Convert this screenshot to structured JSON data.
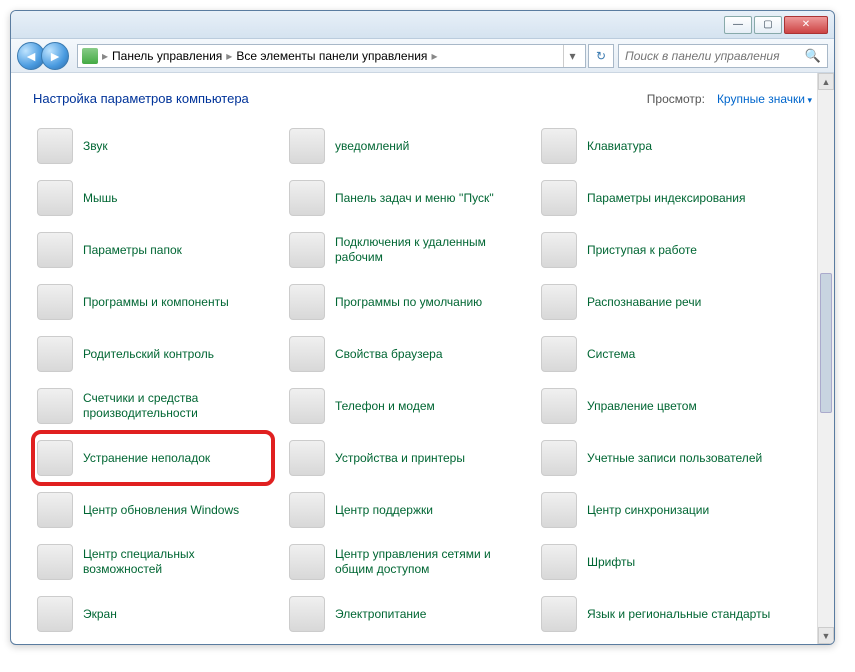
{
  "breadcrumbs": {
    "level1": "Панель управления",
    "level2": "Все элементы панели управления"
  },
  "search": {
    "placeholder": "Поиск в панели управления"
  },
  "header": {
    "title": "Настройка параметров компьютера",
    "view_label": "Просмотр:",
    "view_value": "Крупные значки"
  },
  "items": [
    {
      "label": "Звук",
      "icon": "ic-gray",
      "name": "sound-item"
    },
    {
      "label": "уведомлений",
      "icon": "ic-gray",
      "name": "notification-icons-item"
    },
    {
      "label": "Клавиатура",
      "icon": "ic-gray",
      "name": "keyboard-item"
    },
    {
      "label": "Мышь",
      "icon": "ic-gray",
      "name": "mouse-item"
    },
    {
      "label": "Панель задач и меню ''Пуск''",
      "icon": "ic-blue",
      "name": "taskbar-start-item"
    },
    {
      "label": "Параметры индексирования",
      "icon": "ic-gray",
      "name": "indexing-options-item"
    },
    {
      "label": "Параметры папок",
      "icon": "ic-yellow",
      "name": "folder-options-item"
    },
    {
      "label": "Подключения к удаленным рабочим",
      "icon": "ic-blue",
      "name": "remote-desktop-item"
    },
    {
      "label": "Приступая к работе",
      "icon": "ic-blue",
      "name": "getting-started-item"
    },
    {
      "label": "Программы и компоненты",
      "icon": "ic-gray",
      "name": "programs-features-item"
    },
    {
      "label": "Программы по умолчанию",
      "icon": "ic-green",
      "name": "default-programs-item"
    },
    {
      "label": "Распознавание речи",
      "icon": "ic-gray",
      "name": "speech-recognition-item"
    },
    {
      "label": "Родительский контроль",
      "icon": "ic-green",
      "name": "parental-controls-item"
    },
    {
      "label": "Свойства браузера",
      "icon": "ic-teal",
      "name": "internet-options-item"
    },
    {
      "label": "Система",
      "icon": "ic-blue",
      "name": "system-item"
    },
    {
      "label": "Счетчики и средства производительности",
      "icon": "ic-teal",
      "name": "performance-item"
    },
    {
      "label": "Телефон и модем",
      "icon": "ic-gray",
      "name": "phone-modem-item"
    },
    {
      "label": "Управление цветом",
      "icon": "ic-blue",
      "name": "color-management-item"
    },
    {
      "label": "Устранение неполадок",
      "icon": "ic-blue",
      "name": "troubleshooting-item",
      "hl": true
    },
    {
      "label": "Устройства и принтеры",
      "icon": "ic-gray",
      "name": "devices-printers-item"
    },
    {
      "label": "Учетные записи пользователей",
      "icon": "ic-green",
      "name": "user-accounts-item"
    },
    {
      "label": "Центр обновления Windows",
      "icon": "ic-orange",
      "name": "windows-update-item"
    },
    {
      "label": "Центр поддержки",
      "icon": "ic-blue",
      "name": "action-center-item"
    },
    {
      "label": "Центр синхронизации",
      "icon": "ic-green",
      "name": "sync-center-item"
    },
    {
      "label": "Центр специальных возможностей",
      "icon": "ic-blue",
      "name": "ease-of-access-item"
    },
    {
      "label": "Центр управления сетями и общим доступом",
      "icon": "ic-blue",
      "name": "network-sharing-item"
    },
    {
      "label": "Шрифты",
      "icon": "ic-yellow",
      "name": "fonts-item"
    },
    {
      "label": "Экран",
      "icon": "ic-blue",
      "name": "display-item"
    },
    {
      "label": "Электропитание",
      "icon": "ic-green",
      "name": "power-options-item"
    },
    {
      "label": "Язык и региональные стандарты",
      "icon": "ic-blue",
      "name": "region-language-item"
    }
  ]
}
